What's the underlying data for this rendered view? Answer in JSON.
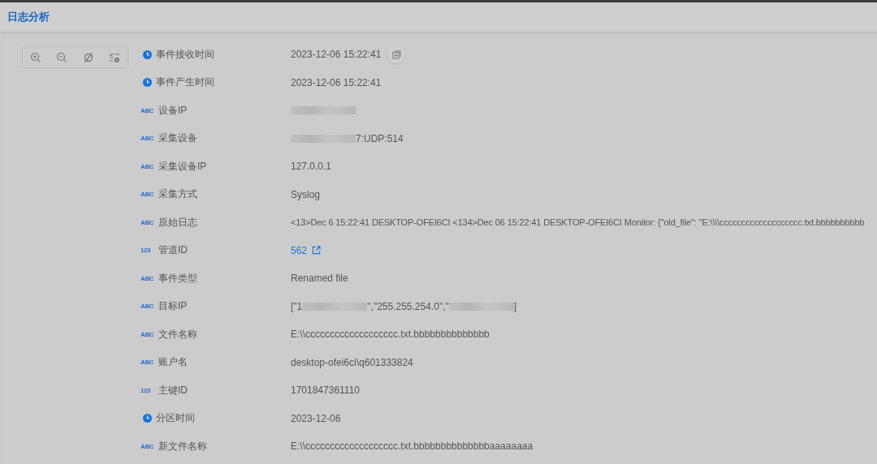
{
  "header": {
    "title": "日志分析"
  },
  "fields": [
    {
      "kind": "time",
      "label": "事件接收时间",
      "value": [
        {
          "kind": "text",
          "text": "2023-12-06 15:22:41"
        }
      ],
      "copy_button": true
    },
    {
      "kind": "time",
      "label": "事件产生时间",
      "value": [
        {
          "kind": "text",
          "text": "2023-12-06 15:22:41"
        }
      ]
    },
    {
      "kind": "string",
      "badge": "ABC",
      "label": "设备IP",
      "value": [
        {
          "kind": "redacted"
        }
      ]
    },
    {
      "kind": "string",
      "badge": "ABC",
      "label": "采集设备",
      "value": [
        {
          "kind": "redacted"
        },
        {
          "kind": "text",
          "text": "7:UDP:514"
        }
      ]
    },
    {
      "kind": "string",
      "badge": "ABC",
      "label": "采集设备IP",
      "value": [
        {
          "kind": "text",
          "text": "127.0.0.1"
        }
      ]
    },
    {
      "kind": "string",
      "badge": "ABC",
      "label": "采集方式",
      "value": [
        {
          "kind": "text",
          "text": "Syslog"
        }
      ]
    },
    {
      "kind": "string",
      "badge": "ABC",
      "label": "原始日志",
      "value": [
        {
          "kind": "text",
          "text": "<13>Dec 6 15:22:41 DESKTOP-OFEI6CI <134>Dec 06 15:22:41 DESKTOP-OFEI6CI Monitor: {\"old_file\": \"E:\\\\\\\\ccccccccccccccccccc.txt.bbbbbbbbbb"
        }
      ]
    },
    {
      "kind": "number",
      "badge": "123",
      "label": "管道ID",
      "value": [
        {
          "kind": "link",
          "text": "562"
        }
      ]
    },
    {
      "kind": "string",
      "badge": "ABC",
      "label": "事件类型",
      "value": [
        {
          "kind": "text",
          "text": "Renamed file"
        }
      ]
    },
    {
      "kind": "string",
      "badge": "ABC",
      "label": "目标IP",
      "value": [
        {
          "kind": "text",
          "text": "[\"1"
        },
        {
          "kind": "redacted"
        },
        {
          "kind": "text",
          "text": "\",\"255.255.254.0\",\""
        },
        {
          "kind": "redacted"
        },
        {
          "kind": "text",
          "text": "]"
        }
      ]
    },
    {
      "kind": "string",
      "badge": "ABC",
      "label": "文件名称",
      "value": [
        {
          "kind": "text",
          "text": "E:\\\\ccccccccccccccccccc.txt.bbbbbbbbbbbbbb"
        }
      ]
    },
    {
      "kind": "string",
      "badge": "ABC",
      "label": "账户名",
      "value": [
        {
          "kind": "text",
          "text": "desktop-ofei6ci\\q601333824"
        }
      ]
    },
    {
      "kind": "number",
      "badge": "123",
      "label": "主键ID",
      "value": [
        {
          "kind": "text",
          "text": "1701847361110"
        }
      ]
    },
    {
      "kind": "time",
      "label": "分区时间",
      "value": [
        {
          "kind": "text",
          "text": "2023-12-06"
        }
      ]
    },
    {
      "kind": "string",
      "badge": "ABC",
      "label": "新文件名称",
      "value": [
        {
          "kind": "text",
          "text": "E:\\\\ccccccccccccccccccc.txt.bbbbbbbbbbbbbbaaaaaaaa"
        }
      ]
    }
  ]
}
